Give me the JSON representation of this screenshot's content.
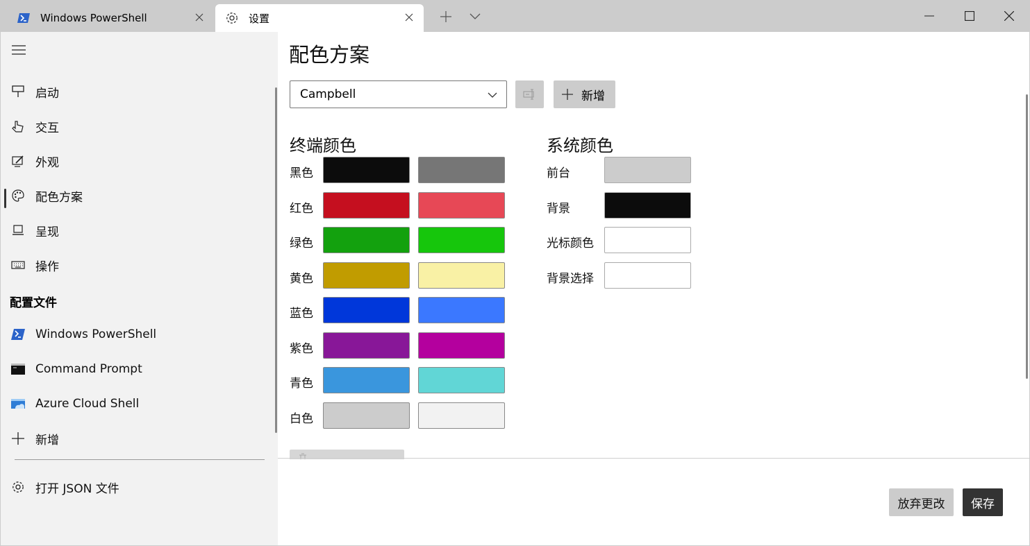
{
  "tabs": [
    {
      "label": "Windows PowerShell",
      "icon": "powershell-icon"
    },
    {
      "label": "设置",
      "icon": "gear-icon"
    }
  ],
  "sidebar": {
    "items": [
      {
        "label": "启动",
        "icon": "launch-icon"
      },
      {
        "label": "交互",
        "icon": "pointer-icon"
      },
      {
        "label": "外观",
        "icon": "appearance-icon"
      },
      {
        "label": "配色方案",
        "icon": "palette-icon",
        "selected": true
      },
      {
        "label": "呈现",
        "icon": "monitor-icon"
      },
      {
        "label": "操作",
        "icon": "keyboard-icon"
      }
    ],
    "profiles_title": "配置文件",
    "profiles": [
      {
        "label": "Windows PowerShell",
        "icon": "powershell-icon"
      },
      {
        "label": "Command Prompt",
        "icon": "cmd-icon"
      },
      {
        "label": "Azure Cloud Shell",
        "icon": "azure-icon"
      },
      {
        "label": "新增",
        "icon": "plus-icon"
      }
    ],
    "open_json": "打开 JSON 文件"
  },
  "main": {
    "title": "配色方案",
    "scheme_selected": "Campbell",
    "add_button": "新增",
    "terminal_colors_title": "终端颜色",
    "system_colors_title": "系统颜色",
    "terminal_colors": [
      {
        "label": "黑色",
        "normal": "#0C0C0C",
        "bright": "#767676"
      },
      {
        "label": "红色",
        "normal": "#C50F1F",
        "bright": "#E74856"
      },
      {
        "label": "绿色",
        "normal": "#13A10E",
        "bright": "#16C60C"
      },
      {
        "label": "黄色",
        "normal": "#C19C00",
        "bright": "#F9F1A5"
      },
      {
        "label": "蓝色",
        "normal": "#0037DA",
        "bright": "#3B78FF"
      },
      {
        "label": "紫色",
        "normal": "#881798",
        "bright": "#B4009E"
      },
      {
        "label": "青色",
        "normal": "#3A96DD",
        "bright": "#61D6D6"
      },
      {
        "label": "白色",
        "normal": "#CCCCCC",
        "bright": "#F2F2F2"
      }
    ],
    "system_colors": [
      {
        "label": "前台",
        "color": "#CCCCCC"
      },
      {
        "label": "背景",
        "color": "#0C0C0C"
      },
      {
        "label": "光标颜色",
        "color": "#FFFFFF"
      },
      {
        "label": "背景选择",
        "color": "#FFFFFF"
      }
    ],
    "discard_button": "放弃更改",
    "save_button": "保存"
  }
}
